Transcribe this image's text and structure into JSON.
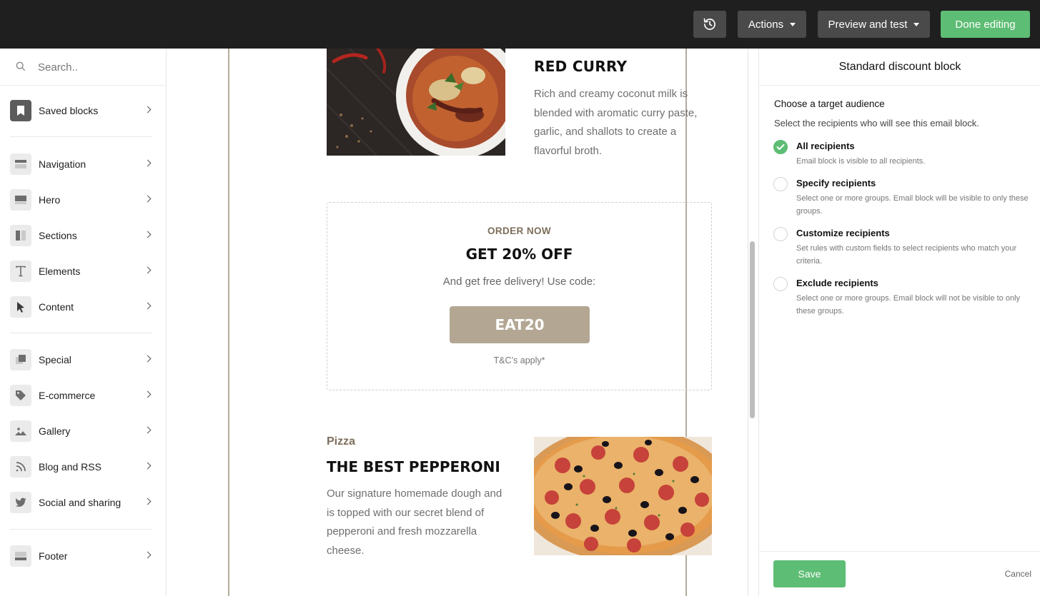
{
  "topbar": {
    "history_icon": "history-icon",
    "actions_label": "Actions",
    "preview_label": "Preview and test",
    "done_label": "Done editing"
  },
  "sidebar": {
    "search_placeholder": "Search..",
    "items": [
      {
        "label": "Saved blocks",
        "icon": "bookmark-icon"
      },
      {
        "label": "Navigation",
        "icon": "navigation-layout-icon"
      },
      {
        "label": "Hero",
        "icon": "hero-layout-icon"
      },
      {
        "label": "Sections",
        "icon": "sections-layout-icon"
      },
      {
        "label": "Elements",
        "icon": "text-icon"
      },
      {
        "label": "Content",
        "icon": "cursor-icon"
      },
      {
        "label": "Special",
        "icon": "special-icon"
      },
      {
        "label": "E-commerce",
        "icon": "tag-icon"
      },
      {
        "label": "Gallery",
        "icon": "image-icon"
      },
      {
        "label": "Blog and RSS",
        "icon": "rss-icon"
      },
      {
        "label": "Social and sharing",
        "icon": "twitter-icon"
      },
      {
        "label": "Footer",
        "icon": "footer-layout-icon"
      }
    ]
  },
  "email": {
    "curry": {
      "title": "RED CURRY",
      "description": "Rich and creamy coconut milk is blended with aromatic curry paste, garlic, and shallots to create a flavorful broth."
    },
    "coupon": {
      "eyebrow": "ORDER NOW",
      "headline": "GET 20% OFF",
      "body": "And get free delivery! Use code:",
      "code": "EAT20",
      "terms": "T&C’s apply*"
    },
    "pizza": {
      "category": "Pizza",
      "title": "THE BEST PEPPERONI",
      "description": "Our signature homemade dough and is topped with our secret blend of pepperoni and fresh mozzarella cheese."
    }
  },
  "panel": {
    "title": "Standard discount block",
    "audience_title": "Choose a target audience",
    "audience_subtitle": "Select the recipients who will see this email block.",
    "options": [
      {
        "label": "All recipients",
        "desc": "Email block is visible to all recipients.",
        "selected": true
      },
      {
        "label": "Specify recipients",
        "desc": "Select one or more groups. Email block will be visible to only these groups.",
        "selected": false
      },
      {
        "label": "Customize recipients",
        "desc": "Set rules with custom fields to select recipients who match your criteria.",
        "selected": false
      },
      {
        "label": "Exclude recipients",
        "desc": "Select one or more groups. Email block will not be visible to only these groups.",
        "selected": false
      }
    ],
    "save_label": "Save",
    "cancel_label": "Cancel"
  },
  "colors": {
    "topbar_bg": "#1f1f1f",
    "accent_green": "#5ebd74",
    "coupon_button": "#b3a794",
    "brand_brown": "#7d6e5b"
  }
}
